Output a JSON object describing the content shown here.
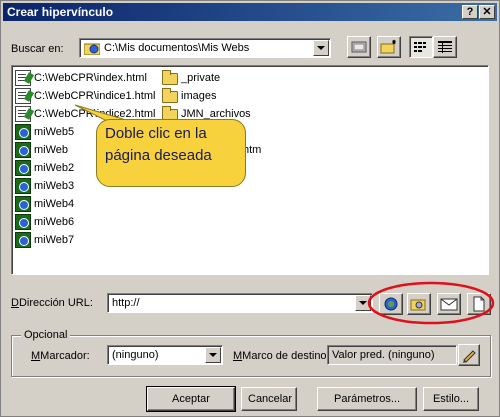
{
  "window": {
    "title": "Crear hipervínculo",
    "help_button": "?",
    "close_button": "✕"
  },
  "lookin": {
    "label": "Buscar en:",
    "value": "C:\\Mis documentos\\Mis Webs"
  },
  "files": [
    {
      "name": "C:\\WebCPR\\index.html",
      "type": "html"
    },
    {
      "name": "C:\\WebCPR\\indice1.html",
      "type": "html"
    },
    {
      "name": "C:\\WebCPR\\indice2.html",
      "type": "html"
    },
    {
      "name": "miWeb5",
      "type": "web"
    },
    {
      "name": "miWeb",
      "type": "web"
    },
    {
      "name": "miWeb2",
      "type": "web"
    },
    {
      "name": "miWeb3",
      "type": "web"
    },
    {
      "name": "miWeb4",
      "type": "web"
    },
    {
      "name": "miWeb6",
      "type": "web"
    },
    {
      "name": "miWeb7",
      "type": "web"
    },
    {
      "name": "_private",
      "type": "folder"
    },
    {
      "name": "images",
      "type": "folder"
    },
    {
      "name": "JMN_archivos",
      "type": "folder"
    },
    {
      "name": "htm",
      "type": "partial"
    }
  ],
  "callout": {
    "line1": "Doble clic en la",
    "line2": "página deseada"
  },
  "url": {
    "label": "Dirección URL:",
    "value": "http://"
  },
  "optional": {
    "legend": "Opcional",
    "bookmark_label": "Marcador:",
    "bookmark_value": "(ninguno)",
    "target_label": "Marco de destino:",
    "target_value": "Valor pred. (ninguno)"
  },
  "buttons": {
    "ok": "Aceptar",
    "cancel": "Cancelar",
    "params": "Parámetros...",
    "style": "Estilo..."
  },
  "colors": {
    "highlight_ring": "#e0101a",
    "callout_fill": "#f7d23c"
  }
}
